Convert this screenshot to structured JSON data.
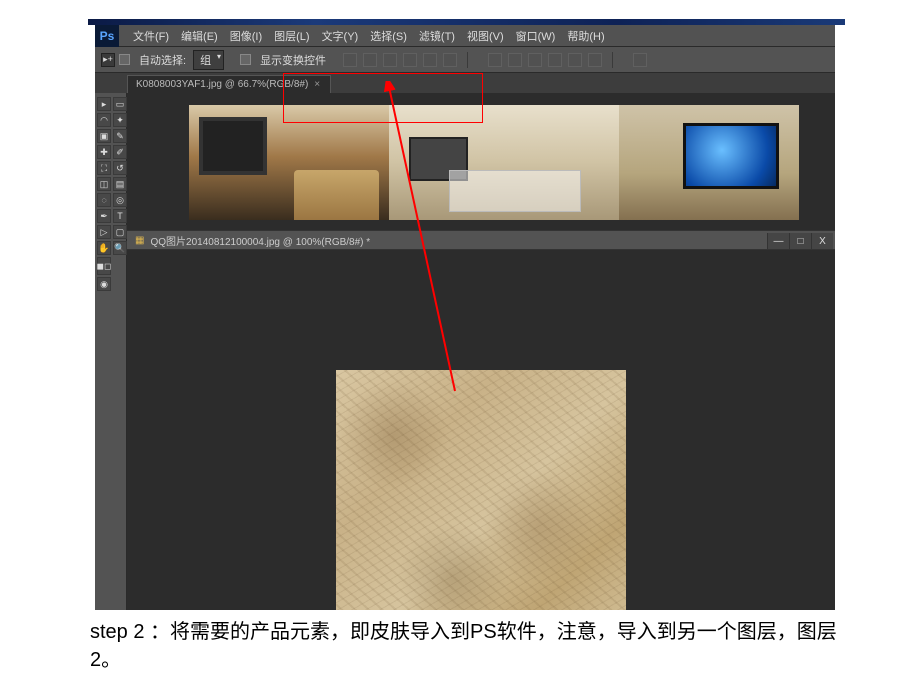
{
  "app": {
    "logo": "Ps"
  },
  "menu": {
    "file": "文件(F)",
    "edit": "编辑(E)",
    "image": "图像(I)",
    "layer": "图层(L)",
    "type": "文字(Y)",
    "select": "选择(S)",
    "filter": "滤镜(T)",
    "view": "视图(V)",
    "window": "窗口(W)",
    "help": "帮助(H)"
  },
  "options": {
    "auto_select": "自动选择:",
    "group": "组",
    "show_transform": "显示变换控件"
  },
  "tabs": {
    "doc1": "K0808003YAF1.jpg @ 66.7%(RGB/8#)",
    "doc2_prefix": "QQ图片20140812100004.jpg @ 100%(RGB/8#) *"
  },
  "tool_names": [
    "move",
    "marquee",
    "lasso",
    "magic-wand",
    "crop",
    "eyedropper",
    "heal",
    "brush",
    "stamp",
    "history-brush",
    "eraser",
    "gradient",
    "blur",
    "dodge",
    "pen",
    "type",
    "path",
    "shape",
    "hand",
    "zoom",
    "fg-bg",
    "quickmask"
  ],
  "win": {
    "min": "—",
    "max": "□",
    "close": "X"
  },
  "caption": "step 2 ：将需要的产品元素，即皮肤导入到PS软件，注意，导入到另一个图层，图层2。"
}
